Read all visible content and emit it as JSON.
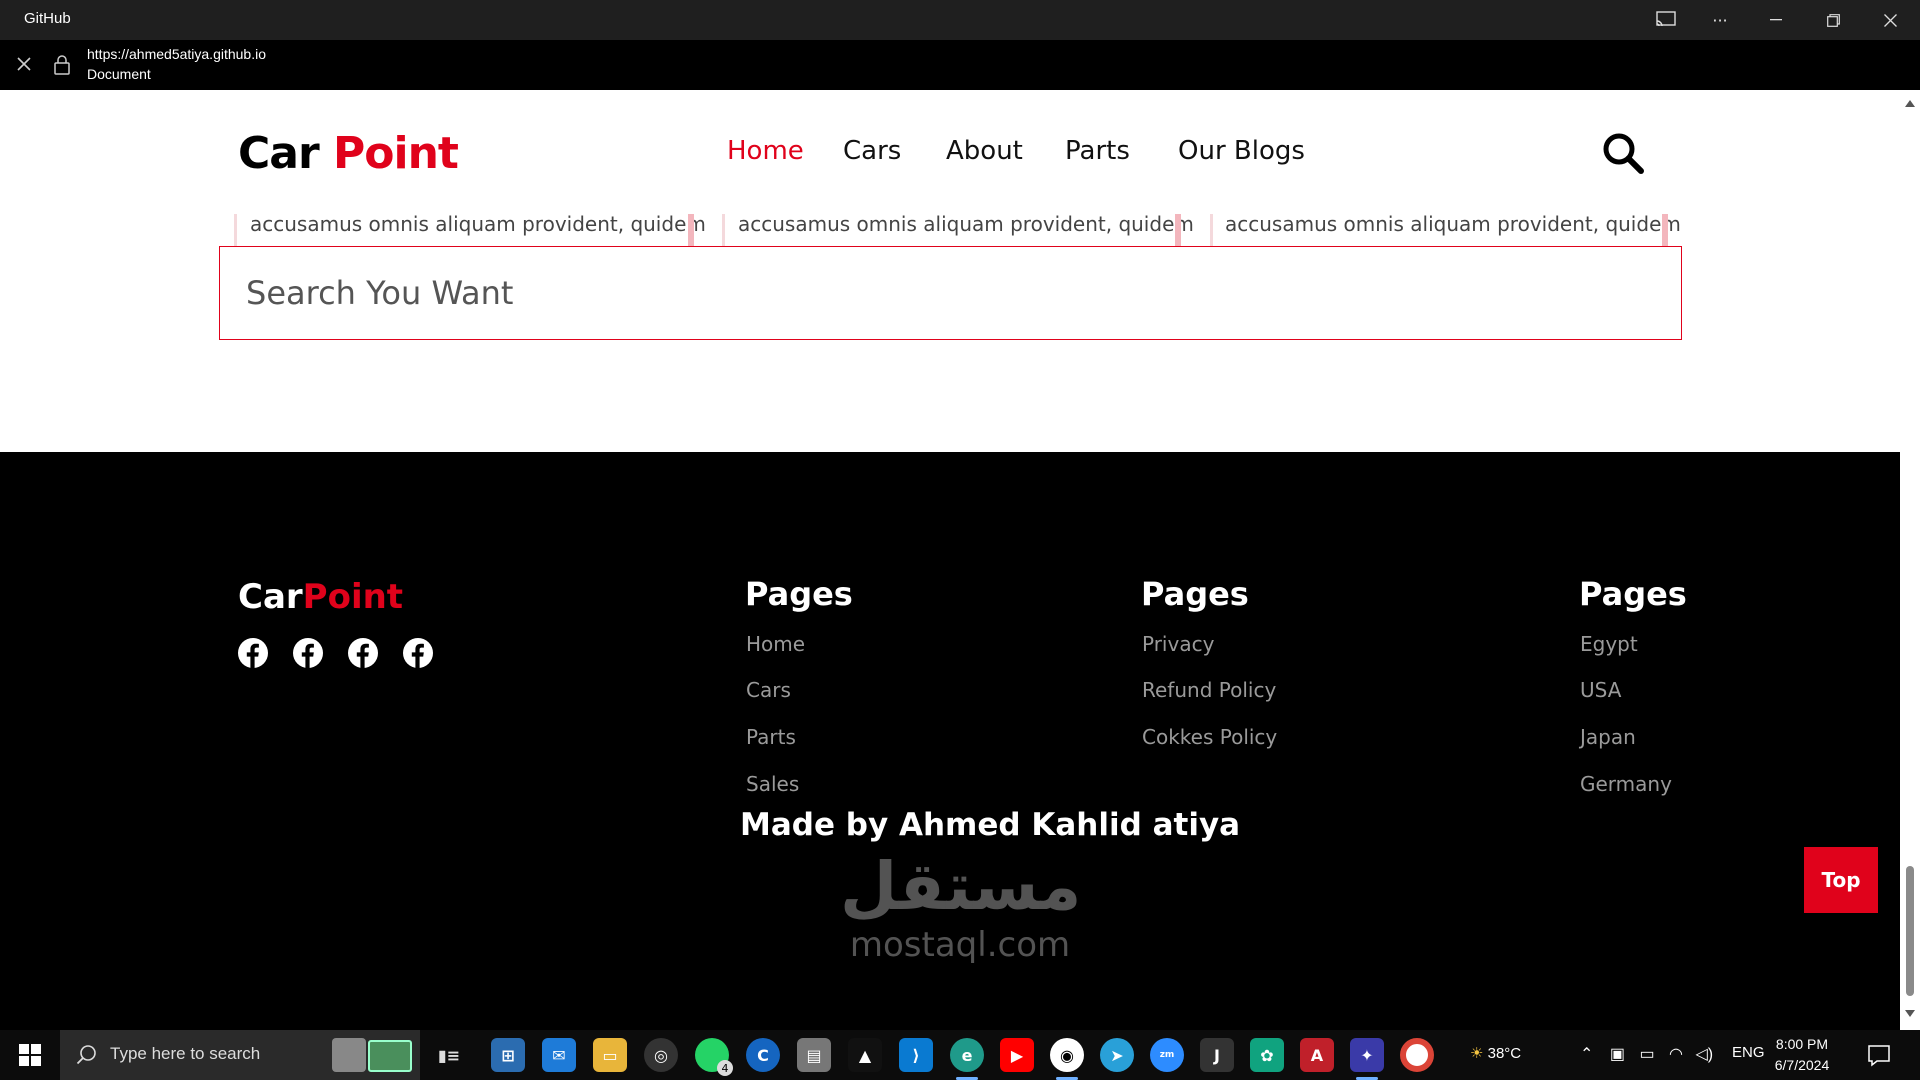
{
  "window": {
    "title": "GitHub"
  },
  "address_bar": {
    "url": "https://ahmed5atiya.github.io",
    "page_title": "Document"
  },
  "navbar": {
    "logo_part1": "Car",
    "logo_part2": "Point",
    "links": [
      {
        "label": "Home",
        "active": true
      },
      {
        "label": "Cars",
        "active": false
      },
      {
        "label": "About",
        "active": false
      },
      {
        "label": "Parts",
        "active": false
      },
      {
        "label": "Our Blogs",
        "active": false
      }
    ],
    "search_icon": "search-icon"
  },
  "cards": [
    {
      "text": "accusamus omnis aliquam provident, quidem"
    },
    {
      "text": "accusamus omnis aliquam provident, quidem"
    },
    {
      "text": "accusamus omnis aliquam provident, quidem"
    }
  ],
  "search": {
    "placeholder": "Search You Want"
  },
  "footer": {
    "logo_part1": "Car",
    "logo_part2": "Point",
    "social_icons": [
      "facebook-icon",
      "facebook-icon",
      "facebook-icon",
      "facebook-icon"
    ],
    "columns": [
      {
        "heading": "Pages",
        "links": [
          "Home",
          "Cars",
          "Parts",
          "Sales"
        ]
      },
      {
        "heading": "Pages",
        "links": [
          "Privacy",
          "Refund Policy",
          "Cokkes Policy"
        ]
      },
      {
        "heading": "Pages",
        "links": [
          "Egypt",
          "USA",
          "Japan",
          "Germany"
        ]
      }
    ],
    "made_by": "Made by Ahmed Kahlid atiya",
    "top_button": "Top",
    "watermark_arabic": "مستقل",
    "watermark_latin": "mostaql.com"
  },
  "taskbar": {
    "search_placeholder": "Type here to search",
    "whatsapp_badge": "4",
    "weather": "38°C",
    "language": "ENG",
    "time": "8:00 PM",
    "date": "6/7/2024"
  },
  "colors": {
    "accent": "#e0021b",
    "footer_bg": "#000000",
    "titlebar_bg": "#1f1f1f"
  }
}
